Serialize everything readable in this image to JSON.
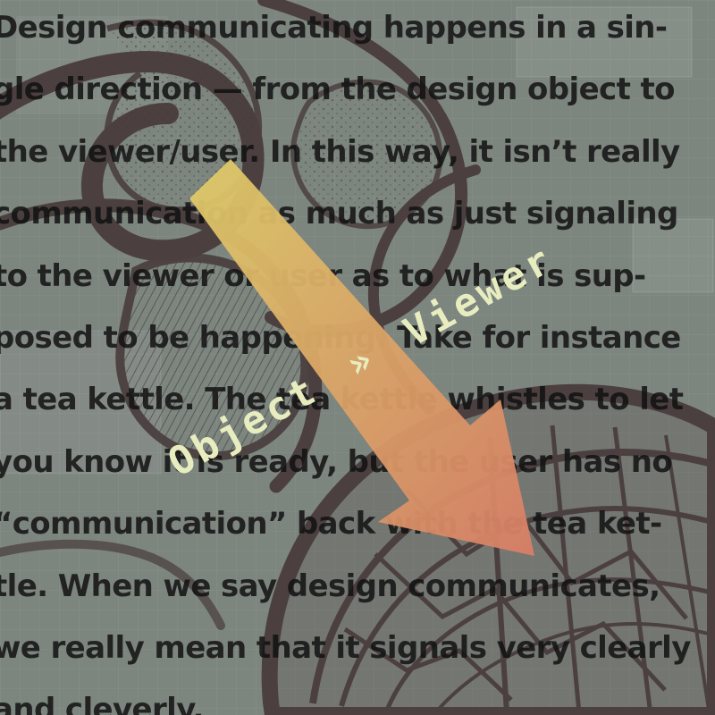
{
  "body_lines": [
    "Design communicating happens in a sin-",
    "gle direction — from the design object to",
    "the viewer/user. In this way, it isn’t really",
    "communication as much as just signaling",
    "to the viewer or user as to what is sup-",
    "posed to be happening. Take for instance",
    "a tea kettle. The tea kettle whistles to let",
    "you know it is ready, but the user has no",
    "“communication” back with the tea ket-",
    "tle. When we say design communicates,",
    "we really mean that it signals very clearly",
    "and cleverly."
  ],
  "diagonal_label": {
    "object": "Object",
    "separator": "»",
    "viewer": "Viewer"
  },
  "colors": {
    "background": "#7d857f",
    "text": "#121212",
    "arrow_start": "#dfcc68",
    "arrow_end": "#d97e66",
    "label": "#e7edbf",
    "ink": "#4d4342"
  },
  "icons": {
    "arrow": "diagonal-arrow-icon"
  }
}
